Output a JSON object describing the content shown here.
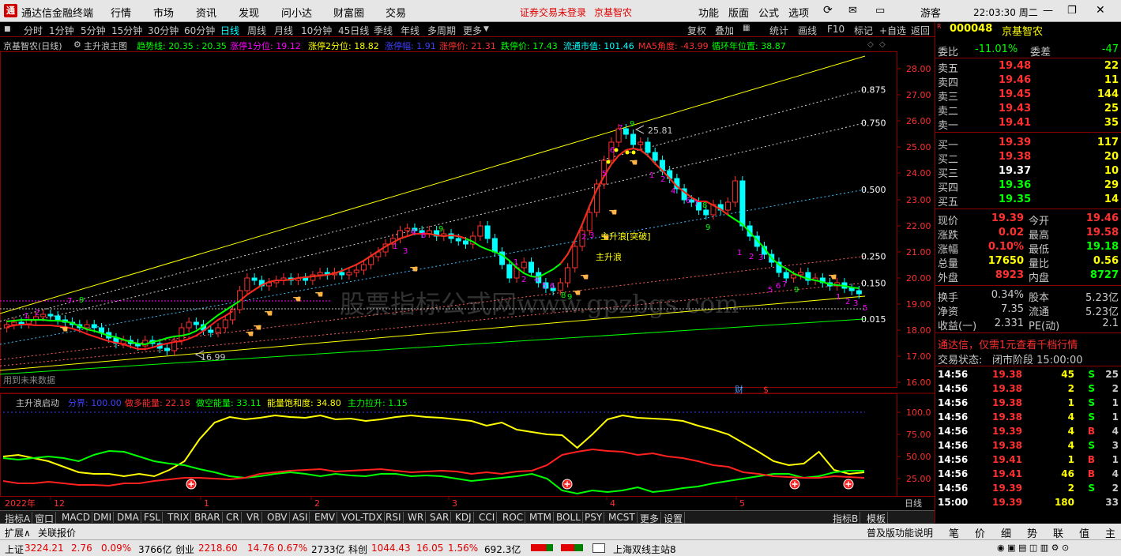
{
  "titlebar": {
    "app_name": "通达信金融终端",
    "menu": [
      "行情",
      "市场",
      "资讯",
      "发现",
      "问小达",
      "财富圈",
      "交易"
    ],
    "notice": "证券交易未登录",
    "stock_name": "京基智农",
    "right_menu": [
      "功能",
      "版面",
      "公式",
      "选项"
    ],
    "user": "游客",
    "clock": "22:03:30 周二"
  },
  "toolbar": {
    "periods": [
      "分时",
      "1分钟",
      "5分钟",
      "15分钟",
      "30分钟",
      "60分钟",
      "日线",
      "周线",
      "月线",
      "10分钟",
      "45日线",
      "季线",
      "年线",
      "多周期",
      "更多"
    ],
    "active": "日线",
    "right_buttons": [
      "复权",
      "叠加",
      "统计",
      "画线",
      "F10",
      "标记",
      "+自选",
      "返回"
    ]
  },
  "main_info": {
    "title": "京基智农(日线)",
    "indicator_name": "主升浪主图",
    "items": [
      {
        "label": "趋势线: 20.35 : 20.35",
        "color": "#00ff00"
      },
      {
        "label": "涨停1分位: 19.12",
        "color": "#ff00ff"
      },
      {
        "label": "涨停2分位: 18.82",
        "color": "#ffff00"
      },
      {
        "label": "涨停幅: 1.91",
        "color": "#4040ff"
      },
      {
        "label": "涨停价: 21.31",
        "color": "#ff3030"
      },
      {
        "label": "跌停价: 17.43",
        "color": "#00ff00"
      },
      {
        "label": "流通市值: 101.46",
        "color": "#00ffff"
      },
      {
        "label": "MA5角度: -43.99",
        "color": "#ff3030"
      },
      {
        "label": "循环年位置: 38.87",
        "color": "#00ff00"
      }
    ]
  },
  "main_chart": {
    "y_ticks": [
      "28.00",
      "27.00",
      "26.00",
      "25.00",
      "24.00",
      "23.00",
      "22.00",
      "21.00",
      "20.00",
      "19.00",
      "18.00",
      "17.00",
      "16.00"
    ],
    "fib_labels": [
      "0.875",
      "0.750",
      "0.500",
      "0.250",
      "0.150",
      "0.015"
    ],
    "high_label": "25.81",
    "low_label": "16.99",
    "annot_breakout": "主升浪[突破]",
    "annot_wave": "主升浪",
    "future_note": "用到未来数据",
    "cai_marker": "财",
    "dollar_marker": "$",
    "watermark": "股票指标公式网www.gpzbgs.com"
  },
  "sub_info": {
    "indicator_name": "主升浪启动",
    "items": [
      {
        "label": "分界: 100.00",
        "color": "#4040ff"
      },
      {
        "label": "做多能量: 22.18",
        "color": "#ff3030"
      },
      {
        "label": "做空能量: 33.11",
        "color": "#00ff00"
      },
      {
        "label": "能量饱和度: 34.80",
        "color": "#ffff00"
      },
      {
        "label": "主力拉升: 1.15",
        "color": "#00ff00"
      }
    ]
  },
  "sub_chart": {
    "y_ticks": [
      "100.0",
      "75.00",
      "50.00",
      "25.00"
    ]
  },
  "x_axis": {
    "labels": [
      "2022年",
      "12",
      "1",
      "2",
      "3",
      "4",
      "5"
    ],
    "period_button": "日线"
  },
  "bottom_tabs": {
    "items": [
      "指标A",
      "窗口",
      "MACD",
      "DMI",
      "DMA",
      "FSL",
      "TRIX",
      "BRAR",
      "CR",
      "VR",
      "OBV",
      "ASI",
      "EMV",
      "VOL-TDX",
      "RSI",
      "WR",
      "SAR",
      "KDJ",
      "CCI",
      "ROC",
      "MTM",
      "BOLL",
      "PSY",
      "MCST",
      "更多",
      "设置"
    ],
    "right": [
      "指标B",
      "模板"
    ]
  },
  "bottom_row2": {
    "items": [
      "扩展∧",
      "关联报价"
    ],
    "right": "普及版功能说明"
  },
  "right_panel": {
    "code": "000048",
    "name": "京基智农",
    "weibi": {
      "label": "委比",
      "value": "-11.01%",
      "label2": "委差",
      "value2": "-47"
    },
    "asks": [
      {
        "label": "卖五",
        "price": "19.48",
        "vol": "22"
      },
      {
        "label": "卖四",
        "price": "19.46",
        "vol": "11"
      },
      {
        "label": "卖三",
        "price": "19.45",
        "vol": "144"
      },
      {
        "label": "卖二",
        "price": "19.43",
        "vol": "25"
      },
      {
        "label": "卖一",
        "price": "19.41",
        "vol": "35"
      }
    ],
    "bids": [
      {
        "label": "买一",
        "price": "19.39",
        "vol": "117"
      },
      {
        "label": "买二",
        "price": "19.38",
        "vol": "20"
      },
      {
        "label": "买三",
        "price": "19.37",
        "vol": "10"
      },
      {
        "label": "买四",
        "price": "19.36",
        "vol": "29"
      },
      {
        "label": "买五",
        "price": "19.35",
        "vol": "14"
      }
    ],
    "stats": [
      {
        "l1": "现价",
        "v1": "19.39",
        "l2": "今开",
        "v2": "19.46"
      },
      {
        "l1": "涨跌",
        "v1": "0.02",
        "l2": "最高",
        "v2": "19.58"
      },
      {
        "l1": "涨幅",
        "v1": "0.10%",
        "l2": "最低",
        "v2": "19.18"
      },
      {
        "l1": "总量",
        "v1": "17650",
        "l2": "量比",
        "v2": "0.56"
      },
      {
        "l1": "外盘",
        "v1": "8923",
        "l2": "内盘",
        "v2": "8727"
      }
    ],
    "stats2": [
      {
        "l1": "换手",
        "v1": "0.34%",
        "l2": "股本",
        "v2": "5.23亿"
      },
      {
        "l1": "净资",
        "v1": "7.35",
        "l2": "流通",
        "v2": "5.23亿"
      },
      {
        "l1": "收益(一)",
        "v1": "2.331",
        "l2": "PE(动)",
        "v2": "2.1"
      }
    ],
    "ad": "通达信，仅需1元查看千档行情",
    "trade_status_label": "交易状态:",
    "trade_status_value": "闭市阶段 15:00:00",
    "ticks": [
      {
        "time": "14:56",
        "price": "19.38",
        "vol": "45",
        "bs": "S",
        "n": "25"
      },
      {
        "time": "14:56",
        "price": "19.38",
        "vol": "2",
        "bs": "S",
        "n": "2"
      },
      {
        "time": "14:56",
        "price": "19.38",
        "vol": "1",
        "bs": "S",
        "n": "1"
      },
      {
        "time": "14:56",
        "price": "19.38",
        "vol": "4",
        "bs": "S",
        "n": "1"
      },
      {
        "time": "14:56",
        "price": "19.39",
        "vol": "4",
        "bs": "B",
        "n": "4"
      },
      {
        "time": "14:56",
        "price": "19.38",
        "vol": "4",
        "bs": "S",
        "n": "3"
      },
      {
        "time": "14:56",
        "price": "19.41",
        "vol": "1",
        "bs": "B",
        "n": "1"
      },
      {
        "time": "14:56",
        "price": "19.41",
        "vol": "46",
        "bs": "B",
        "n": "4"
      },
      {
        "time": "14:56",
        "price": "19.39",
        "vol": "2",
        "bs": "S",
        "n": "2"
      },
      {
        "time": "15:00",
        "price": "19.39",
        "vol": "180",
        "bs": "",
        "n": "33"
      }
    ],
    "tabs": [
      "笔",
      "价",
      "细",
      "势",
      "联",
      "值",
      "主"
    ]
  },
  "status": {
    "sh_label": "上证",
    "sh_value": "3224.21",
    "sh_chg": "2.76",
    "sh_pct": "0.09%",
    "sh_amt": "3766亿",
    "cy_label": "创业",
    "cy_value": "2218.60",
    "cy_chg": "14.76",
    "cy_pct": "0.67%",
    "cy_amt": "2733亿",
    "kc_label": "科创",
    "kc_value": "1044.43",
    "kc_chg": "16.05",
    "kc_pct": "1.56%",
    "kc_amt": "692.3亿",
    "server": "上海双线主站8"
  },
  "colors": {
    "up": "#ff3030",
    "down": "#00ffff",
    "green": "#00ff00",
    "yellow": "#ffff00",
    "border": "#8b0000"
  }
}
